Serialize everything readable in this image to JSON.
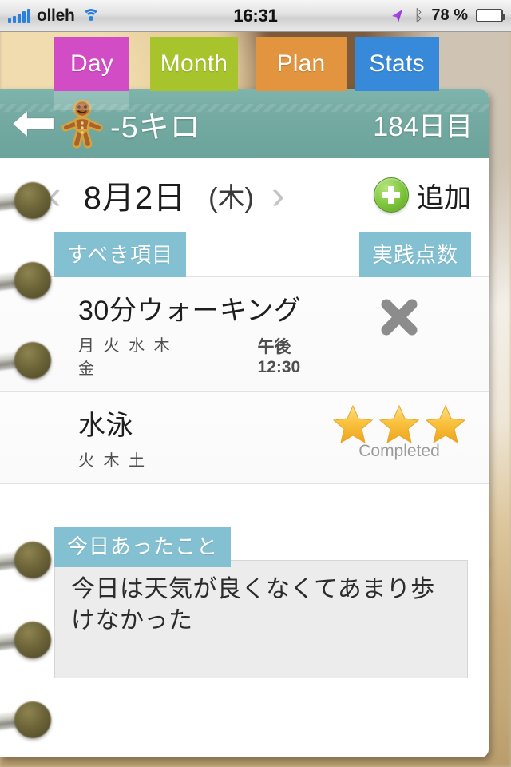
{
  "statusbar": {
    "carrier": "olleh",
    "clock": "16:31",
    "battery_percent": "78 %",
    "signal_icon": "signal-bars-icon",
    "wifi_icon": "wifi-icon",
    "location_icon": "location-arrow-icon",
    "bluetooth_icon": "bluetooth-icon",
    "bluetooth_glyph": "ᛒ",
    "battery_icon": "battery-icon"
  },
  "tabs": [
    {
      "id": "day",
      "label": "Day",
      "color": "#d24cc6",
      "active": true
    },
    {
      "id": "month",
      "label": "Month",
      "color": "#a7c42c",
      "active": false
    },
    {
      "id": "plan",
      "label": "Plan",
      "color": "#e2943e",
      "active": false
    },
    {
      "id": "stats",
      "label": "Stats",
      "color": "#3789da",
      "active": false
    }
  ],
  "appbar": {
    "back_icon": "back-arrow-icon",
    "mascot_icon": "gingerbread-man-icon",
    "title": "-5キロ",
    "day_count": "184日目",
    "background_color": "#74aaa2"
  },
  "datenav": {
    "prev_icon": "chevron-left-icon",
    "next_icon": "chevron-right-icon",
    "date": "8月2日",
    "day_of_week": "(木)",
    "add_icon": "plus-circle-icon",
    "add_label": "追加"
  },
  "sections": {
    "todo_label": "すべき項目",
    "score_label": "実践点数",
    "notes_label": "今日あったこと"
  },
  "tasks": [
    {
      "title": "30分ウォーキング",
      "days": "月 火 水 木 金",
      "time": "午後 12:30",
      "status": "not-done",
      "status_icon": "x-mark-icon",
      "stars": 0,
      "status_label": ""
    },
    {
      "title": "水泳",
      "days": "火 木 土",
      "time": "",
      "status": "completed",
      "status_icon": "star-icon",
      "stars": 3,
      "status_label": "Completed"
    }
  ],
  "notes": {
    "text": "今日は天気が良くなくてあまり歩けなかった"
  },
  "binder": {
    "ring_icon": "binder-ring-icon",
    "ring_count": 6
  },
  "colors": {
    "chip": "#83c1d2",
    "header_teal": "#74aaa2",
    "add_green": "#7cc43a",
    "star_gold": "#f5b731"
  }
}
